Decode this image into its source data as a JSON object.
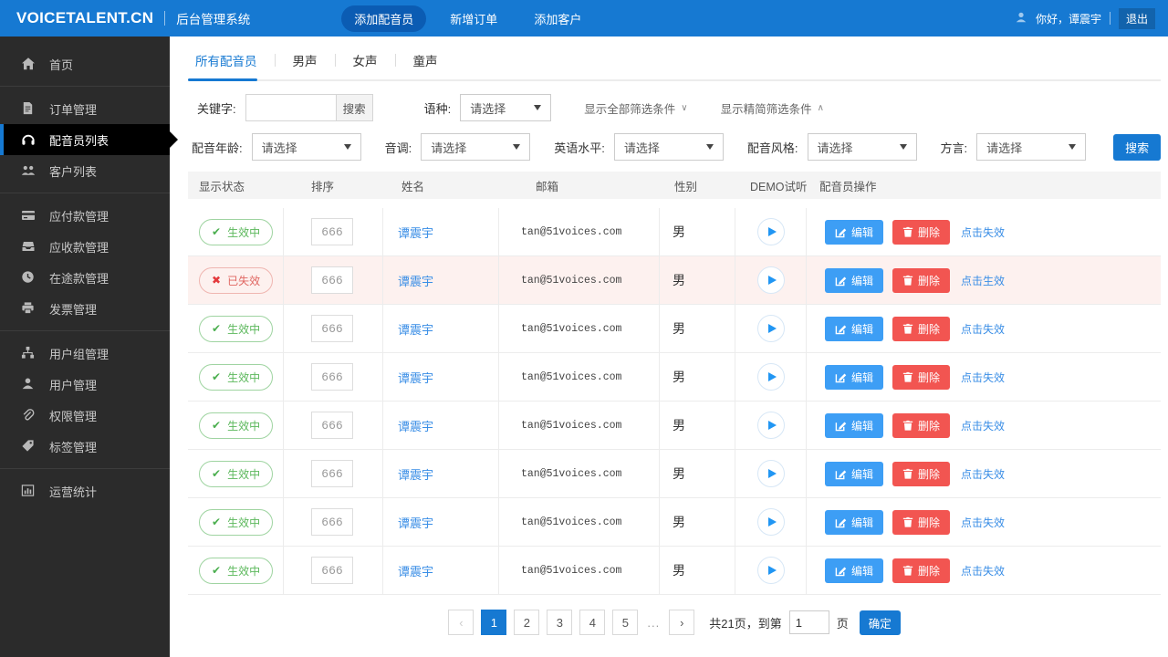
{
  "colors": {
    "primary": "#1679d2",
    "topbar_bg": "#1679d2",
    "sidebar_bg": "#2b2b2b",
    "success": "#5cb85c",
    "danger": "#f25551",
    "link": "#3a8ee6"
  },
  "topbar": {
    "brand": "VOICETALENT.CN",
    "subtitle": "后台管理系统",
    "nav": [
      {
        "key": "add-voice-actor",
        "label": "添加配音员",
        "active": true
      },
      {
        "key": "add-order",
        "label": "新增订单",
        "active": false
      },
      {
        "key": "add-customer",
        "label": "添加客户",
        "active": false
      }
    ],
    "greeting": "你好，谭震宇",
    "logout": "退出"
  },
  "sidebar": {
    "groups": [
      {
        "items": [
          {
            "key": "home",
            "icon": "home",
            "label": "首页"
          }
        ]
      },
      {
        "items": [
          {
            "key": "order-management",
            "icon": "document",
            "label": "订单管理"
          },
          {
            "key": "voice-actor-list",
            "icon": "headset",
            "label": "配音员列表",
            "active": true
          },
          {
            "key": "customer-list",
            "icon": "users",
            "label": "客户列表"
          }
        ]
      },
      {
        "items": [
          {
            "key": "payables-management",
            "icon": "card",
            "label": "应付款管理"
          },
          {
            "key": "receivables-management",
            "icon": "inbox",
            "label": "应收款管理"
          },
          {
            "key": "in-transit-funds-management",
            "icon": "clock",
            "label": "在途款管理"
          },
          {
            "key": "invoice-management",
            "icon": "printer",
            "label": "发票管理"
          }
        ]
      },
      {
        "items": [
          {
            "key": "user-group-management",
            "icon": "sitemap",
            "label": "用户组管理"
          },
          {
            "key": "user-management",
            "icon": "user",
            "label": "用户管理"
          },
          {
            "key": "permission-management",
            "icon": "paperclip",
            "label": "权限管理"
          },
          {
            "key": "tag-management",
            "icon": "tag",
            "label": "标签管理"
          }
        ]
      },
      {
        "items": [
          {
            "key": "operation-statistics",
            "icon": "chart",
            "label": "运营统计"
          }
        ]
      }
    ]
  },
  "tabs": [
    {
      "key": "all-voice-actors",
      "label": "所有配音员",
      "active": true
    },
    {
      "key": "male-voice",
      "label": "男声",
      "active": false
    },
    {
      "key": "female-voice",
      "label": "女声",
      "active": false
    },
    {
      "key": "child-voice",
      "label": "童声",
      "active": false
    }
  ],
  "filters": {
    "keyword_label": "关键字:",
    "keyword_value": "",
    "keyword_search": "搜索",
    "language_label": "语种:",
    "language_value": "请选择",
    "toggle_all": "显示全部筛选条件",
    "toggle_simple": "显示精简筛选条件",
    "chevron_down": "∨",
    "chevron_up": "∧",
    "row2": [
      {
        "key": "voice-age",
        "label": "配音年龄:",
        "value": "请选择"
      },
      {
        "key": "tone",
        "label": "音调:",
        "value": "请选择"
      },
      {
        "key": "english-level",
        "label": "英语水平:",
        "value": "请选择"
      },
      {
        "key": "voice-style",
        "label": "配音风格:",
        "value": "请选择"
      },
      {
        "key": "dialect",
        "label": "方言:",
        "value": "请选择"
      }
    ],
    "search_button": "搜索"
  },
  "table": {
    "headers": [
      "显示状态",
      "排序",
      "姓名",
      "邮箱",
      "性别",
      "DEMO试听",
      "配音员操作"
    ],
    "check_icon": "✔",
    "cross_icon": "✖",
    "edit_label": "编辑",
    "delete_label": "删除",
    "rows": [
      {
        "status": "active",
        "status_label": "生效中",
        "sort": "666",
        "name": "谭震宇",
        "email": "tan@51voices.com",
        "gender": "男",
        "toggle_label": "点击失效"
      },
      {
        "status": "inactive",
        "status_label": "已失效",
        "sort": "666",
        "name": "谭震宇",
        "email": "tan@51voices.com",
        "gender": "男",
        "toggle_label": "点击生效"
      },
      {
        "status": "active",
        "status_label": "生效中",
        "sort": "666",
        "name": "谭震宇",
        "email": "tan@51voices.com",
        "gender": "男",
        "toggle_label": "点击失效"
      },
      {
        "status": "active",
        "status_label": "生效中",
        "sort": "666",
        "name": "谭震宇",
        "email": "tan@51voices.com",
        "gender": "男",
        "toggle_label": "点击失效"
      },
      {
        "status": "active",
        "status_label": "生效中",
        "sort": "666",
        "name": "谭震宇",
        "email": "tan@51voices.com",
        "gender": "男",
        "toggle_label": "点击失效"
      },
      {
        "status": "active",
        "status_label": "生效中",
        "sort": "666",
        "name": "谭震宇",
        "email": "tan@51voices.com",
        "gender": "男",
        "toggle_label": "点击失效"
      },
      {
        "status": "active",
        "status_label": "生效中",
        "sort": "666",
        "name": "谭震宇",
        "email": "tan@51voices.com",
        "gender": "男",
        "toggle_label": "点击失效"
      },
      {
        "status": "active",
        "status_label": "生效中",
        "sort": "666",
        "name": "谭震宇",
        "email": "tan@51voices.com",
        "gender": "男",
        "toggle_label": "点击失效"
      }
    ]
  },
  "pagination": {
    "prev": "‹",
    "next": "›",
    "pages": [
      "1",
      "2",
      "3",
      "4",
      "5"
    ],
    "active_page": "1",
    "ellipsis": "...",
    "total_text": "共21页，到第",
    "goto_value": "1",
    "page_suffix": "页",
    "confirm": "确定"
  }
}
